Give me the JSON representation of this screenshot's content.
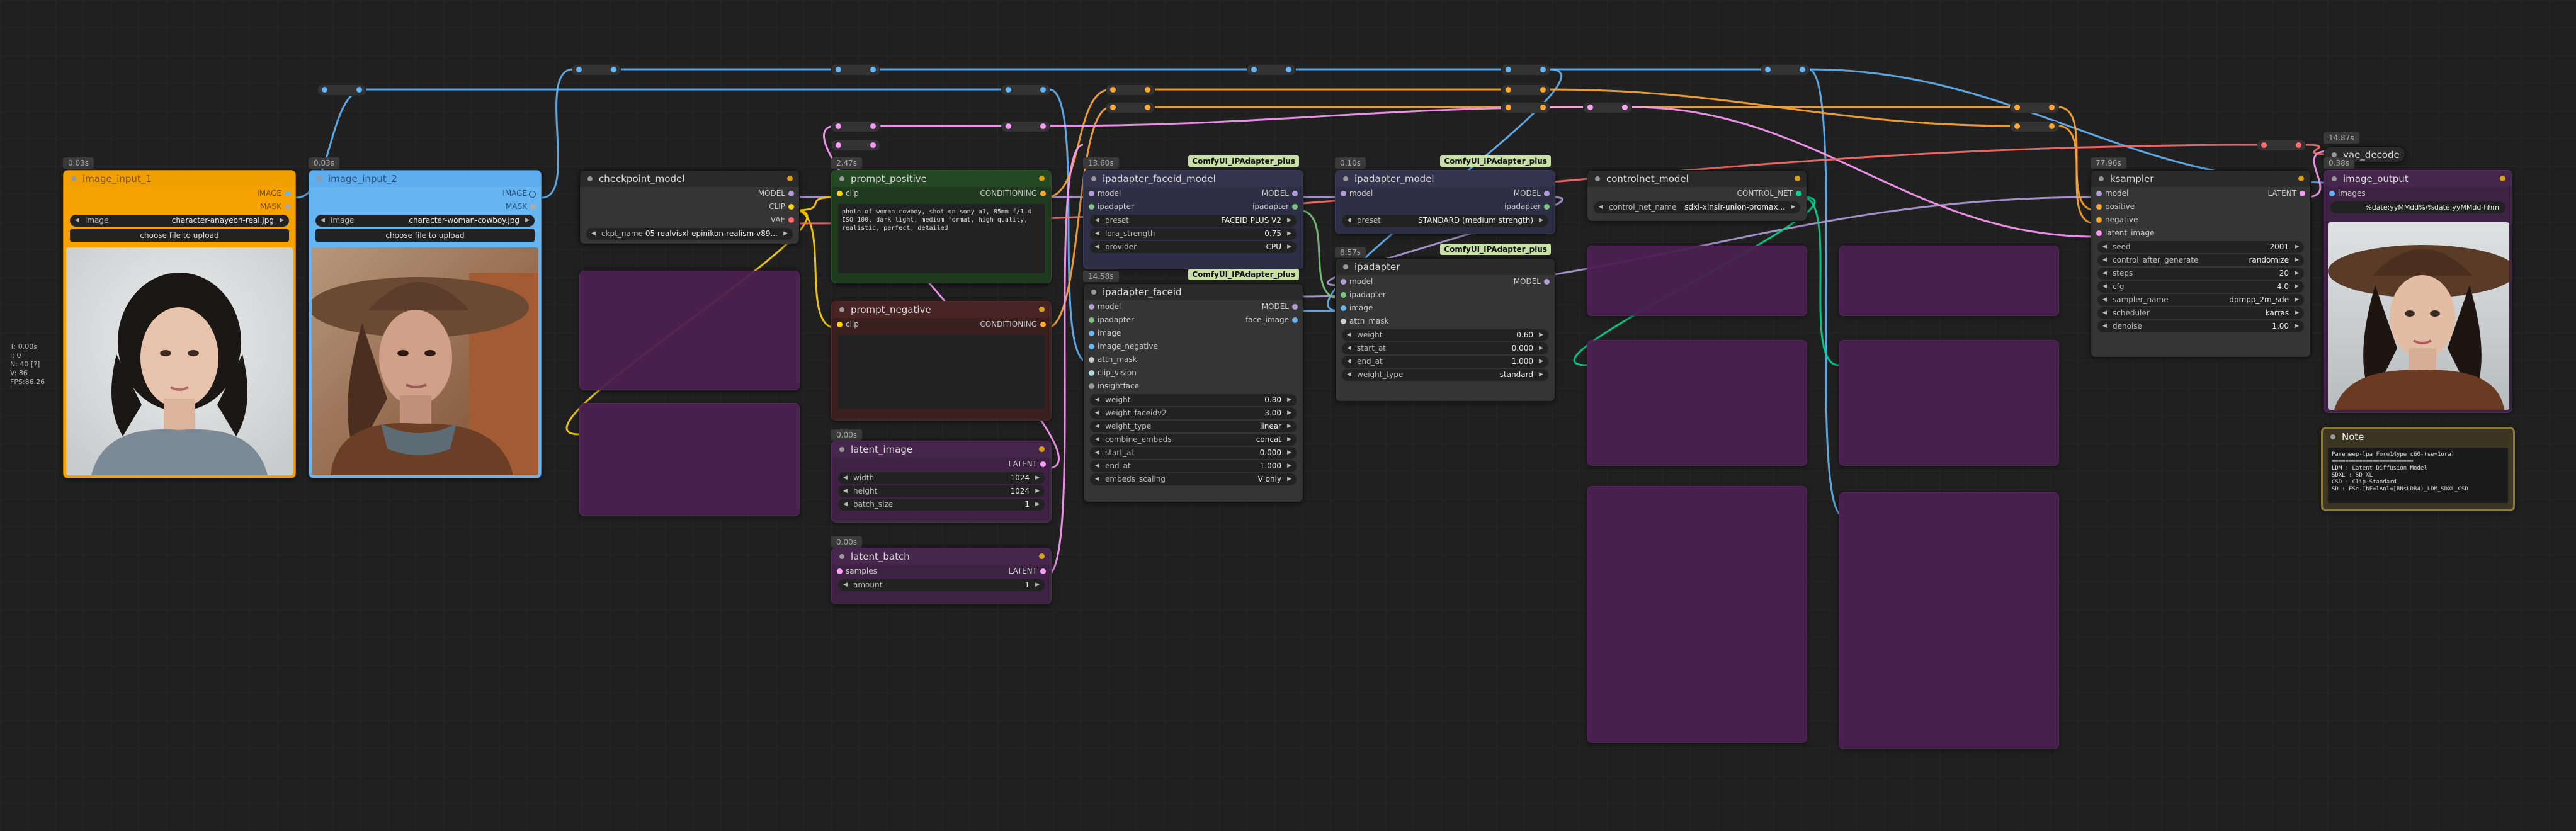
{
  "stats": {
    "lines": [
      "T: 0.00s",
      "I: 0",
      "N: 40 [?]",
      "V: 86",
      "FPS:86.26"
    ]
  },
  "colors": {
    "model": "#b39ddb",
    "clip": "#ffd500",
    "vae": "#ff6e6e",
    "image": "#64b5f6",
    "conditioning": "#ffa931",
    "latent": "#ff9cf9",
    "ipadapter": "#7bc67b",
    "control_net": "#00d78d",
    "clip_vision": "#a8dadc",
    "insightface": "#999999"
  },
  "nodes": {
    "load_image_1": {
      "time": "0.03s",
      "title": "image_input_1",
      "outputs": [
        "IMAGE",
        "MASK"
      ],
      "widget_label": "image",
      "widget_value": "character-anayeon-real.jpg",
      "button": "choose file to upload"
    },
    "load_image_2": {
      "time": "0.03s",
      "title": "image_input_2",
      "outputs": [
        "IMAGE",
        "MASK"
      ],
      "widget_label": "image",
      "widget_value": "character-woman-cowboy.jpg",
      "button": "choose file to upload"
    },
    "checkpoint": {
      "title": "checkpoint_model",
      "outputs": [
        "MODEL",
        "CLIP",
        "VAE"
      ],
      "widget_label": "ckpt_name",
      "widget_value": "05 realvisxl-epinikon-realism-v89..."
    },
    "prompt_positive": {
      "time": "2.47s",
      "title": "prompt_positive",
      "input": "clip",
      "output": "CONDITIONING",
      "text": "photo of woman cowboy, shot on sony a1, 85mm f/1.4 ISO 100, dark light, medium format, high quality, realistic, perfect, detailed"
    },
    "prompt_negative": {
      "title": "prompt_negative",
      "input": "clip",
      "output": "CONDITIONING",
      "text": ""
    },
    "latent_image": {
      "time": "0.00s",
      "title": "latent_image",
      "output": "LATENT",
      "widgets": [
        {
          "label": "width",
          "value": "1024"
        },
        {
          "label": "height",
          "value": "1024"
        },
        {
          "label": "batch_size",
          "value": "1"
        }
      ]
    },
    "latent_batch": {
      "time": "0.00s",
      "title": "latent_batch",
      "input": "samples",
      "output": "LATENT",
      "widgets": [
        {
          "label": "amount",
          "value": "1"
        }
      ]
    },
    "ipadapter_faceid_model": {
      "time": "13.60s",
      "pack": "ComfyUI_IPAdapter_plus",
      "title": "ipadapter_faceid_model",
      "inputs": [
        "model",
        "ipadapter"
      ],
      "outputs": [
        "MODEL",
        "ipadapter"
      ],
      "widgets": [
        {
          "label": "preset",
          "value": "FACEID PLUS V2"
        },
        {
          "label": "lora_strength",
          "value": "0.75"
        },
        {
          "label": "provider",
          "value": "CPU"
        }
      ]
    },
    "ipadapter_faceid": {
      "time": "14.58s",
      "pack": "ComfyUI_IPAdapter_plus",
      "title": "ipadapter_faceid",
      "inputs": [
        "model",
        "ipadapter",
        "image",
        "image_negative",
        "attn_mask",
        "clip_vision",
        "insightface"
      ],
      "outputs": [
        "MODEL",
        "face_image"
      ],
      "widgets": [
        {
          "label": "weight",
          "value": "0.80"
        },
        {
          "label": "weight_faceidv2",
          "value": "3.00"
        },
        {
          "label": "weight_type",
          "value": "linear"
        },
        {
          "label": "combine_embeds",
          "value": "concat"
        },
        {
          "label": "start_at",
          "value": "0.000"
        },
        {
          "label": "end_at",
          "value": "1.000"
        },
        {
          "label": "embeds_scaling",
          "value": "V only"
        }
      ]
    },
    "ipadapter_model": {
      "time": "0.10s",
      "pack": "ComfyUI_IPAdapter_plus",
      "title": "ipadapter_model",
      "inputs": [
        "model"
      ],
      "outputs": [
        "MODEL",
        "ipadapter"
      ],
      "widgets": [
        {
          "label": "preset",
          "value": "STANDARD (medium strength)"
        }
      ]
    },
    "ipadapter": {
      "time": "8.57s",
      "pack": "ComfyUI_IPAdapter_plus",
      "title": "ipadapter",
      "inputs": [
        "model",
        "ipadapter",
        "image",
        "attn_mask"
      ],
      "outputs": [
        "MODEL"
      ],
      "widgets": [
        {
          "label": "weight",
          "value": "0.60"
        },
        {
          "label": "start_at",
          "value": "0.000"
        },
        {
          "label": "end_at",
          "value": "1.000"
        },
        {
          "label": "weight_type",
          "value": "standard"
        }
      ]
    },
    "controlnet_model": {
      "title": "controlnet_model",
      "output": "CONTROL_NET",
      "widget_label": "control_net_name",
      "widget_value": "sdxl-xinsir-union-promax..."
    },
    "ksampler": {
      "time": "77.96s",
      "title": "ksampler",
      "inputs": [
        "model",
        "positive",
        "negative",
        "latent_image"
      ],
      "output": "LATENT",
      "widgets": [
        {
          "label": "seed",
          "value": "2001"
        },
        {
          "label": "control_after_generate",
          "value": "randomize"
        },
        {
          "label": "steps",
          "value": "20"
        },
        {
          "label": "cfg",
          "value": "4.0"
        },
        {
          "label": "sampler_name",
          "value": "dpmpp_2m_sde"
        },
        {
          "label": "scheduler",
          "value": "karras"
        },
        {
          "label": "denoise",
          "value": "1.00"
        }
      ]
    },
    "vae_decode": {
      "time": "14.87s",
      "title": "vae_decode"
    },
    "image_output": {
      "time": "0.38s",
      "title": "image_output",
      "input": "images",
      "filename": "%date:yyMMdd%/%date:yyMMdd-hhm"
    },
    "note": {
      "title": "Note",
      "lines": [
        "Paremeep-lpa Fore14ype c60-(se=1ora)",
        "========================",
        "LDM  : Latent Diffusion Model",
        "SDXL : SD XL",
        "CSD  : Clip Standard",
        "SD   : FSe-[hF=lAnl=[RNsLDR4)_LDM_SDXL_CSD"
      ]
    }
  }
}
